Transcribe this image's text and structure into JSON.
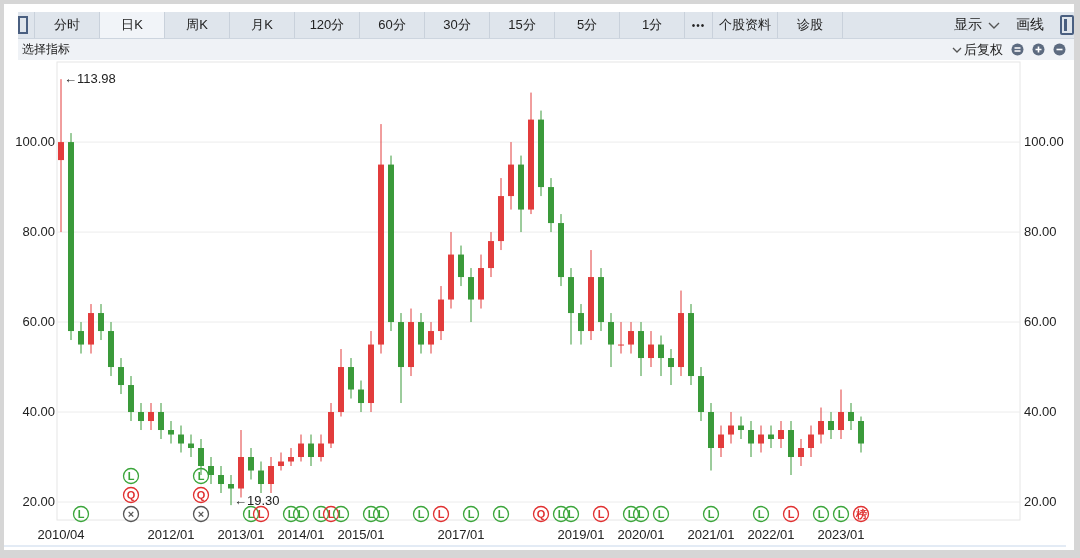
{
  "tabs": [
    {
      "label": "分时",
      "selected": false,
      "kind": "tab"
    },
    {
      "label": "日K",
      "selected": true,
      "kind": "tab"
    },
    {
      "label": "周K",
      "selected": false,
      "kind": "tab"
    },
    {
      "label": "月K",
      "selected": false,
      "kind": "tab"
    },
    {
      "label": "120分",
      "selected": false,
      "kind": "tab"
    },
    {
      "label": "60分",
      "selected": false,
      "kind": "tab"
    },
    {
      "label": "30分",
      "selected": false,
      "kind": "tab"
    },
    {
      "label": "15分",
      "selected": false,
      "kind": "tab"
    },
    {
      "label": "5分",
      "selected": false,
      "kind": "tab"
    },
    {
      "label": "1分",
      "selected": false,
      "kind": "tab"
    },
    {
      "label": "•••",
      "selected": false,
      "kind": "more"
    },
    {
      "label": "个股资料",
      "selected": false,
      "kind": "tab"
    },
    {
      "label": "诊股",
      "selected": false,
      "kind": "tab"
    }
  ],
  "toolbar_right": {
    "display_menu": "显示",
    "draw_button": "画线"
  },
  "indicator_bar": {
    "select_label": "选择指标",
    "adjust_menu": "后复权"
  },
  "chart": {
    "chart_data": {
      "type": "candlestick",
      "categories": [
        "2010/04",
        null,
        null,
        null,
        null,
        null,
        null,
        null,
        null,
        null,
        null,
        "2012/01",
        null,
        null,
        null,
        null,
        null,
        null,
        "2013/01",
        null,
        null,
        null,
        null,
        null,
        "2014/01",
        null,
        null,
        null,
        null,
        null,
        "2015/01",
        null,
        null,
        null,
        null,
        null,
        null,
        null,
        null,
        null,
        "2017/01",
        null,
        null,
        null,
        null,
        null,
        null,
        null,
        null,
        null,
        null,
        null,
        "2019/01",
        null,
        null,
        null,
        null,
        null,
        "2020/01",
        null,
        null,
        null,
        null,
        null,
        null,
        "2021/01",
        null,
        null,
        null,
        null,
        null,
        "2022/01",
        null,
        null,
        null,
        null,
        null,
        null,
        "2023/01",
        null,
        null
      ],
      "ohlc": [
        [
          96,
          113.98,
          80,
          100
        ],
        [
          100,
          102,
          56,
          58
        ],
        [
          58,
          60,
          53,
          55
        ],
        [
          55,
          64,
          53,
          62
        ],
        [
          62,
          64,
          56,
          58
        ],
        [
          58,
          60,
          48,
          50
        ],
        [
          50,
          52,
          44,
          46
        ],
        [
          46,
          48,
          38,
          40
        ],
        [
          40,
          42,
          36,
          38
        ],
        [
          38,
          42,
          36,
          40
        ],
        [
          40,
          42,
          34,
          36
        ],
        [
          36,
          38,
          33,
          35
        ],
        [
          35,
          37,
          31,
          33
        ],
        [
          33,
          35,
          30,
          32
        ],
        [
          32,
          34,
          26,
          28
        ],
        [
          28,
          30,
          24,
          26
        ],
        [
          26,
          28,
          22,
          24
        ],
        [
          24,
          26,
          19.3,
          23
        ],
        [
          23,
          36,
          21,
          30
        ],
        [
          30,
          32,
          25,
          27
        ],
        [
          27,
          29,
          22,
          24
        ],
        [
          24,
          30,
          22,
          28
        ],
        [
          28,
          31,
          27,
          29
        ],
        [
          29,
          32,
          28,
          30
        ],
        [
          30,
          35,
          29,
          33
        ],
        [
          33,
          35,
          28,
          30
        ],
        [
          30,
          35,
          29,
          33
        ],
        [
          33,
          42,
          32,
          40
        ],
        [
          40,
          54,
          39,
          50
        ],
        [
          50,
          52,
          43,
          45
        ],
        [
          45,
          47,
          40,
          42
        ],
        [
          42,
          58,
          40,
          55
        ],
        [
          55,
          104,
          53,
          95
        ],
        [
          95,
          97,
          58,
          60
        ],
        [
          60,
          62,
          42,
          50
        ],
        [
          50,
          63,
          48,
          60
        ],
        [
          60,
          62,
          53,
          55
        ],
        [
          55,
          60,
          53,
          58
        ],
        [
          58,
          68,
          56,
          65
        ],
        [
          65,
          80,
          63,
          75
        ],
        [
          75,
          77,
          68,
          70
        ],
        [
          70,
          72,
          60,
          65
        ],
        [
          65,
          75,
          63,
          72
        ],
        [
          72,
          80,
          70,
          78
        ],
        [
          78,
          92,
          76,
          88
        ],
        [
          88,
          100,
          85,
          95
        ],
        [
          95,
          97,
          80,
          85
        ],
        [
          85,
          111,
          84,
          105
        ],
        [
          105,
          107,
          88,
          90
        ],
        [
          90,
          92,
          80,
          82
        ],
        [
          82,
          84,
          68,
          70
        ],
        [
          70,
          72,
          55,
          62
        ],
        [
          62,
          64,
          55,
          58
        ],
        [
          58,
          76,
          56,
          70
        ],
        [
          70,
          72,
          58,
          60
        ],
        [
          60,
          62,
          50,
          55
        ],
        [
          55,
          60,
          53,
          55
        ],
        [
          55,
          60,
          53,
          58
        ],
        [
          58,
          60,
          48,
          52
        ],
        [
          52,
          58,
          50,
          55
        ],
        [
          55,
          57,
          48,
          52
        ],
        [
          52,
          54,
          46,
          50
        ],
        [
          50,
          67,
          48,
          62
        ],
        [
          62,
          64,
          46,
          48
        ],
        [
          48,
          50,
          38,
          40
        ],
        [
          40,
          42,
          27,
          32
        ],
        [
          32,
          37,
          30,
          35
        ],
        [
          35,
          40,
          33,
          37
        ],
        [
          37,
          39,
          34,
          36
        ],
        [
          36,
          38,
          30,
          33
        ],
        [
          33,
          37,
          31,
          35
        ],
        [
          35,
          37,
          32,
          34
        ],
        [
          34,
          38,
          32,
          36
        ],
        [
          36,
          38,
          26,
          30
        ],
        [
          30,
          34,
          28,
          32
        ],
        [
          32,
          37,
          30,
          35
        ],
        [
          35,
          41,
          33,
          38
        ],
        [
          38,
          40,
          34,
          36
        ],
        [
          36,
          45,
          34,
          40
        ],
        [
          40,
          42,
          36,
          38
        ],
        [
          38,
          39,
          31,
          33
        ]
      ],
      "ylim": [
        16,
        117.8
      ],
      "grid": true,
      "yticks": [
        {
          "value": 20,
          "label": "20.00"
        },
        {
          "value": 40,
          "label": "40.00"
        },
        {
          "value": 60,
          "label": "60.00"
        },
        {
          "value": 80,
          "label": "80.00"
        },
        {
          "value": 100,
          "label": "100.00"
        }
      ],
      "annotations": [
        "←113.98",
        "←19.30"
      ]
    },
    "event_markers": {
      "candle_2": [
        {
          "label": "L",
          "color": "#3aa53a"
        }
      ],
      "candle_7": [
        {
          "label": "L",
          "color": "#3aa53a"
        },
        {
          "label": "Q",
          "color": "#e03030"
        },
        {
          "label": "×",
          "color": "#555555"
        }
      ],
      "candle_14": [
        {
          "label": "L",
          "color": "#3aa53a"
        },
        {
          "label": "Q",
          "color": "#e03030"
        },
        {
          "label": "×",
          "color": "#555555"
        }
      ],
      "candle_19": [
        {
          "label": "L",
          "color": "#3aa53a"
        }
      ],
      "candle_20": [
        {
          "label": "L",
          "color": "#e03030"
        }
      ],
      "candle_23": [
        {
          "label": "L",
          "color": "#3aa53a"
        }
      ],
      "candle_24": [
        {
          "label": "L",
          "color": "#3aa53a"
        }
      ],
      "candle_26": [
        {
          "label": "L",
          "color": "#3aa53a"
        }
      ],
      "candle_27": [
        {
          "label": "L",
          "color": "#e03030"
        }
      ],
      "candle_28": [
        {
          "label": "L",
          "color": "#3aa53a"
        }
      ],
      "candle_31": [
        {
          "label": "L",
          "color": "#3aa53a"
        }
      ],
      "candle_32": [
        {
          "label": "L",
          "color": "#3aa53a"
        }
      ],
      "candle_36": [
        {
          "label": "L",
          "color": "#3aa53a"
        }
      ],
      "candle_38": [
        {
          "label": "L",
          "color": "#e03030"
        }
      ],
      "candle_41": [
        {
          "label": "L",
          "color": "#3aa53a"
        }
      ],
      "candle_44": [
        {
          "label": "L",
          "color": "#3aa53a"
        }
      ],
      "candle_48": [
        {
          "label": "Q",
          "color": "#e03030"
        }
      ],
      "candle_50": [
        {
          "label": "L",
          "color": "#3aa53a"
        }
      ],
      "candle_51": [
        {
          "label": "L",
          "color": "#3aa53a"
        }
      ],
      "candle_54": [
        {
          "label": "L",
          "color": "#e03030"
        }
      ],
      "candle_57": [
        {
          "label": "L",
          "color": "#3aa53a"
        }
      ],
      "candle_58": [
        {
          "label": "L",
          "color": "#3aa53a"
        }
      ],
      "candle_60": [
        {
          "label": "L",
          "color": "#3aa53a"
        }
      ],
      "candle_65": [
        {
          "label": "L",
          "color": "#3aa53a"
        }
      ],
      "candle_70": [
        {
          "label": "L",
          "color": "#3aa53a"
        }
      ],
      "candle_73": [
        {
          "label": "L",
          "color": "#e03030"
        }
      ],
      "candle_76": [
        {
          "label": "L",
          "color": "#3aa53a"
        }
      ],
      "candle_78": [
        {
          "label": "L",
          "color": "#3aa53a"
        }
      ],
      "candle_80": [
        {
          "label": "榜",
          "color": "#e03030"
        }
      ]
    }
  }
}
